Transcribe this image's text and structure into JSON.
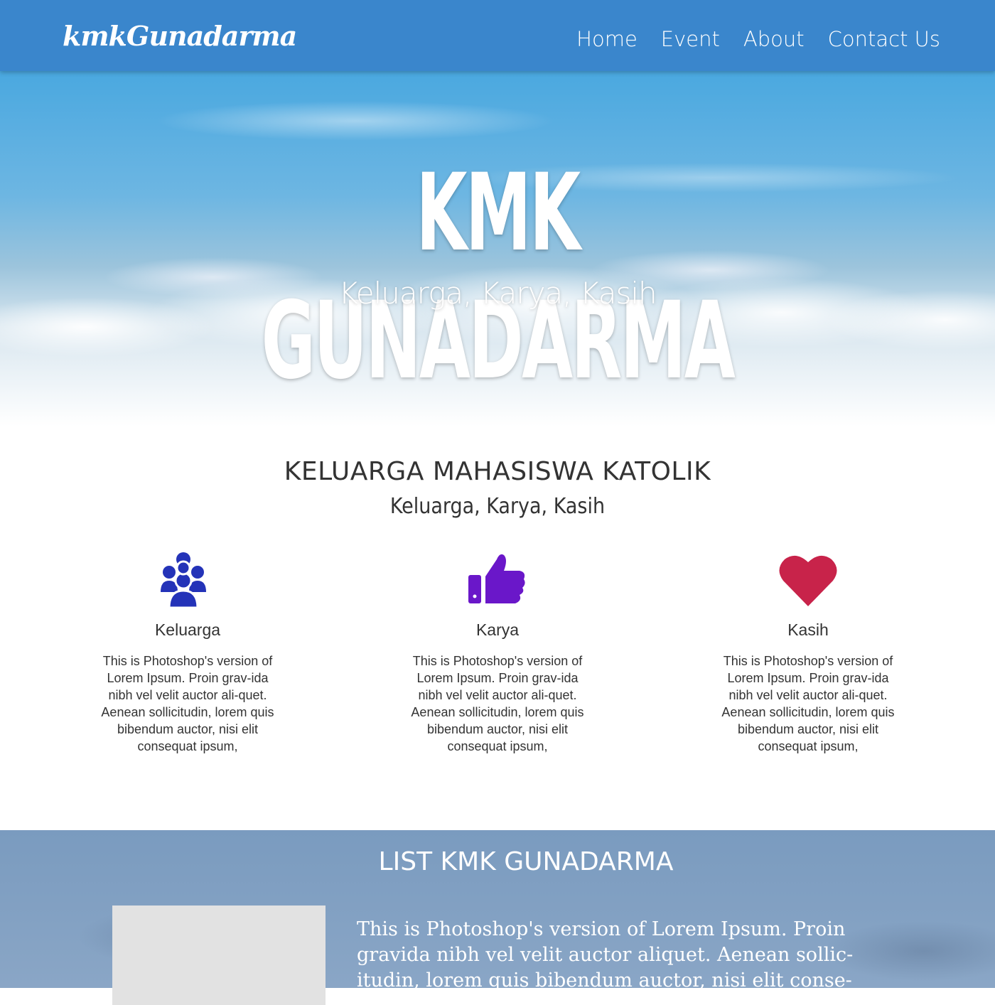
{
  "navbar": {
    "logo": "kmkGunadarma",
    "links": [
      "Home",
      "Event",
      "About",
      "Contact Us"
    ]
  },
  "hero": {
    "title": "KMK GUNADARMA",
    "subtitle": "Keluarga, Karya, Kasih"
  },
  "about": {
    "heading": "KELUARGA MAHASISWA KATOLIK",
    "subheading": "Keluarga, Karya, Kasih",
    "features": [
      {
        "icon": "users-icon",
        "title": "Keluarga",
        "text": "This is Photoshop's version of Lorem Ipsum. Proin grav-ida nibh vel velit auctor ali-quet. Aenean sollicitudin, lorem quis bibendum auctor, nisi elit consequat ipsum,",
        "color": "#2433b8"
      },
      {
        "icon": "thumbs-up-icon",
        "title": "Karya",
        "text": "This is Photoshop's version of Lorem Ipsum. Proin grav-ida nibh vel velit auctor ali-quet. Aenean sollicitudin, lorem quis bibendum auctor, nisi elit consequat ipsum,",
        "color": "#6a17c9"
      },
      {
        "icon": "heart-icon",
        "title": "Kasih",
        "text": "This is Photoshop's version of Lorem Ipsum. Proin grav-ida nibh vel velit auctor ali-quet. Aenean sollicitudin, lorem quis bibendum auctor, nisi elit consequat ipsum,",
        "color": "#c8234a"
      }
    ]
  },
  "list": {
    "heading": "LIST KMK GUNADARMA",
    "text": "This is Photoshop's version  of Lorem Ipsum. Proin gravida nibh vel velit auctor aliquet. Aenean sollic-itudin, lorem quis bibendum auctor, nisi elit conse-"
  },
  "colors": {
    "navbar": "#3a86cc",
    "list_section": "#7a9bbf"
  }
}
